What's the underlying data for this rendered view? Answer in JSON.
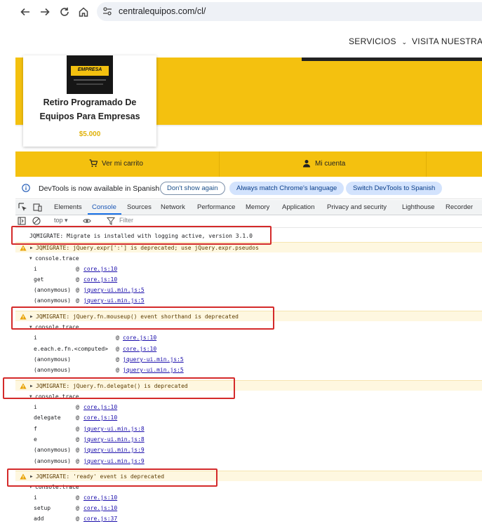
{
  "browser": {
    "url": "centralequipos.com/cl/"
  },
  "site": {
    "nav": {
      "servicios": "SERVICIOS",
      "visita": "VISITA NUESTRA TI"
    },
    "product": {
      "image_logo_text": "EMPRESA",
      "title_line1": "Retiro Programado De",
      "title_line2": "Equipos Para Empresas",
      "price": "$5.000"
    },
    "cart_bar": {
      "cart_label": "Ver mi carrito",
      "account_label": "Mi cuenta"
    },
    "colors": {
      "brand_yellow": "#f4c10f",
      "price_gold": "#e0b20a"
    }
  },
  "devtools": {
    "info": {
      "text": "DevTools is now available in Spanish",
      "dont_show": "Don't show again",
      "match_language": "Always match Chrome's language",
      "switch_spanish": "Switch DevTools to Spanish"
    },
    "tabs": [
      "Elements",
      "Console",
      "Sources",
      "Network",
      "Performance",
      "Memory",
      "Application",
      "Privacy and security",
      "Lighthouse",
      "Recorder"
    ],
    "active_tab": "Console",
    "toolbar": {
      "context": "top ▾",
      "filter_placeholder": "Filter"
    },
    "console": {
      "migrate_info": "JQMIGRATE: Migrate is installed with logging active, version 3.1.0",
      "warn1": "JQMIGRATE: jQuery.expr[':'] is deprecated; use jQuery.expr.pseudos",
      "warn2": "JQMIGRATE: jQuery.fn.mouseup() event shorthand is deprecated",
      "warn3": "JQMIGRATE: jQuery.fn.delegate() is deprecated",
      "warn4": "JQMIGRATE: 'ready' event is deprecated",
      "trace_label": "console.trace",
      "at": "@",
      "trace1": [
        {
          "fn": "i",
          "src": "core.js:10"
        },
        {
          "fn": "get",
          "src": "core.js:10"
        },
        {
          "fn": "(anonymous)",
          "src": "jquery-ui.min.js:5"
        },
        {
          "fn": "(anonymous)",
          "src": "jquery-ui.min.js:5"
        }
      ],
      "trace2": [
        {
          "fn": "i",
          "src": "core.js:10"
        },
        {
          "fn": "e.each.e.fn.<computed>",
          "src": "core.js:10"
        },
        {
          "fn": "(anonymous)",
          "src": "jquery-ui.min.js:5"
        },
        {
          "fn": "(anonymous)",
          "src": "jquery-ui.min.js:5"
        }
      ],
      "trace3": [
        {
          "fn": "i",
          "src": "core.js:10"
        },
        {
          "fn": "delegate",
          "src": "core.js:10"
        },
        {
          "fn": "f",
          "src": "jquery-ui.min.js:8"
        },
        {
          "fn": "e",
          "src": "jquery-ui.min.js:8"
        },
        {
          "fn": "(anonymous)",
          "src": "jquery-ui.min.js:9"
        },
        {
          "fn": "(anonymous)",
          "src": "jquery-ui.min.js:9"
        }
      ],
      "trace4": [
        {
          "fn": "i",
          "src": "core.js:10"
        },
        {
          "fn": "setup",
          "src": "core.js:10"
        },
        {
          "fn": "add",
          "src": "core.js:37"
        }
      ]
    }
  }
}
